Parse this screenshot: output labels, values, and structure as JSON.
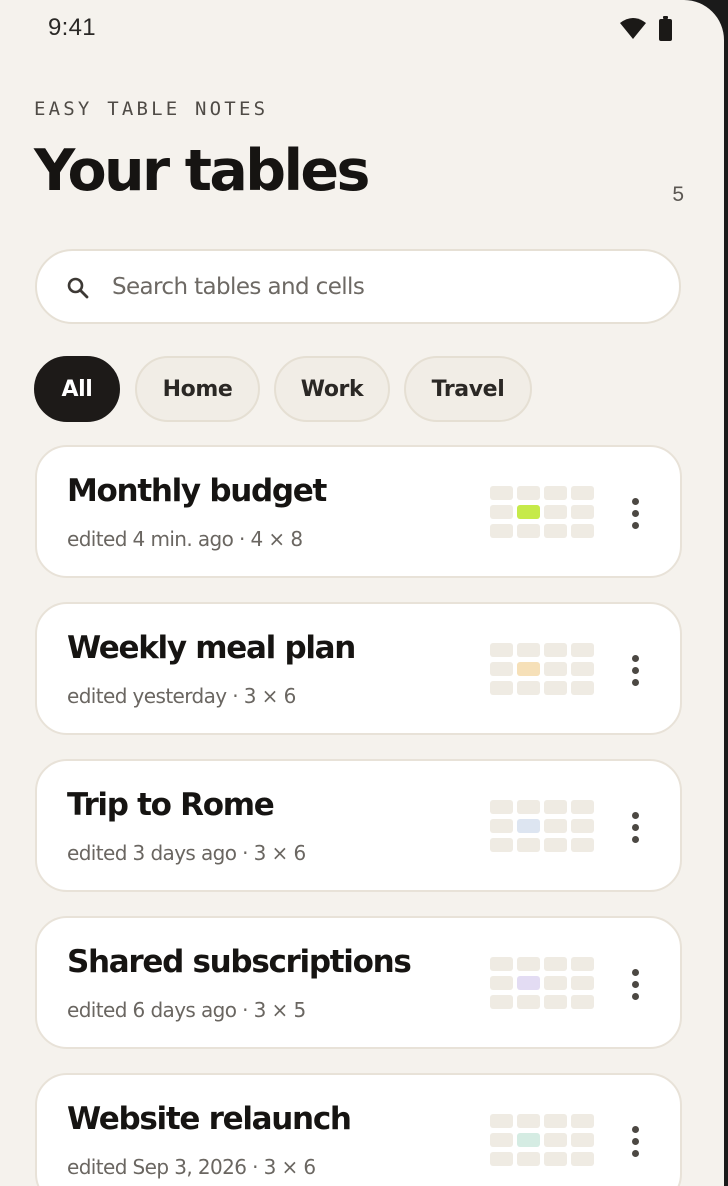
{
  "status_bar": {
    "time": "9:41",
    "icons": [
      "wifi-icon",
      "battery-icon"
    ]
  },
  "header": {
    "app_name": "EASY TABLE NOTES",
    "title": "Your tables",
    "count": "5"
  },
  "search": {
    "placeholder": "Search tables and cells",
    "value": "",
    "icon": "search-icon"
  },
  "filters": {
    "selected": "All",
    "chips": [
      {
        "label": "All"
      },
      {
        "label": "Home"
      },
      {
        "label": "Work"
      },
      {
        "label": "Travel"
      }
    ]
  },
  "tables": [
    {
      "title": "Monthly budget",
      "meta": "edited 4 min. ago · 4 × 8",
      "accent": "#c6ea4a",
      "more_icon": "more-vertical-icon"
    },
    {
      "title": "Weekly meal plan",
      "meta": "edited yesterday · 3 × 6",
      "accent": "#f6e0b8",
      "more_icon": "more-vertical-icon"
    },
    {
      "title": "Trip to Rome",
      "meta": "edited 3 days ago · 3 × 6",
      "accent": "#dde5f1",
      "more_icon": "more-vertical-icon"
    },
    {
      "title": "Shared subscriptions",
      "meta": "edited 6 days ago · 3 × 5",
      "accent": "#e3dcf3",
      "more_icon": "more-vertical-icon"
    },
    {
      "title": "Website relaunch",
      "meta": "edited Sep 3, 2026 · 3 × 6",
      "accent": "#d5ece3",
      "more_icon": "more-vertical-icon"
    }
  ],
  "colors": {
    "background": "#f5f2ed",
    "card": "#ffffff",
    "chip_active": "#1d1a18",
    "text_primary": "#161412",
    "text_secondary": "#6a6661"
  }
}
